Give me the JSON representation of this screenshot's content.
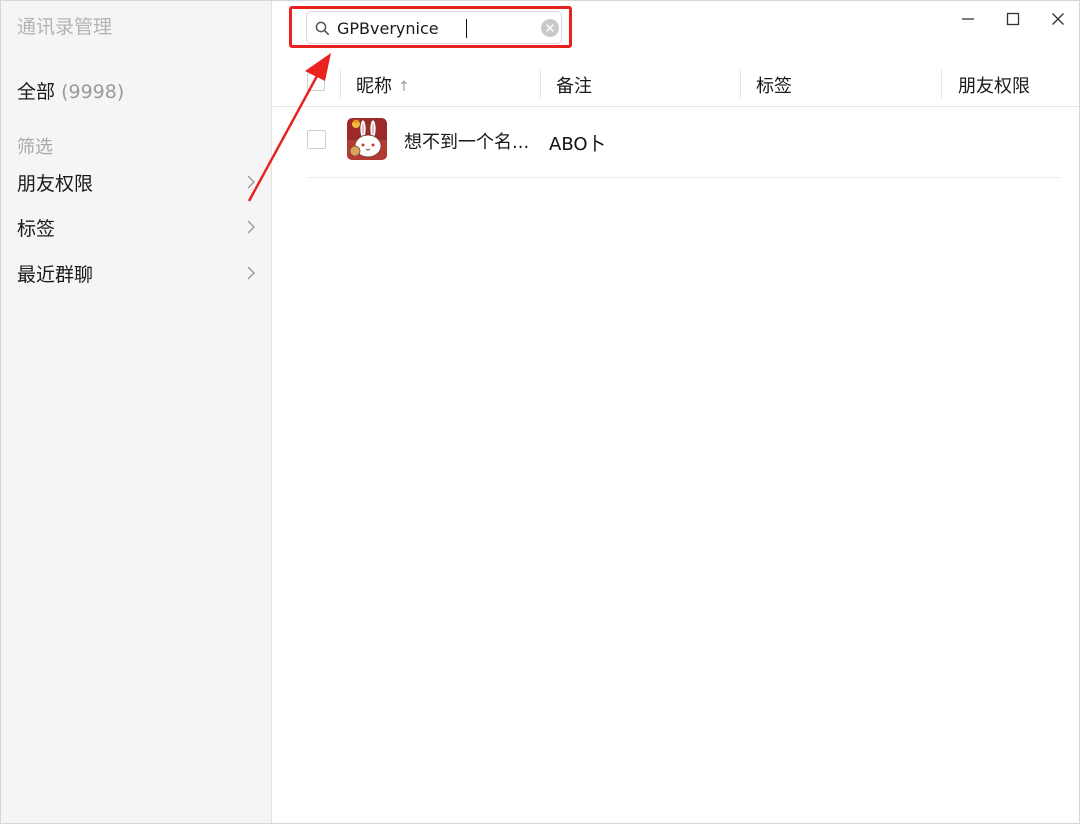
{
  "sidebar": {
    "title": "通讯录管理",
    "all_label": "全部",
    "all_count": "(9998)",
    "filter_label": "筛选",
    "items": [
      {
        "label": "朋友权限"
      },
      {
        "label": "标签"
      },
      {
        "label": "最近群聊"
      }
    ]
  },
  "search": {
    "value": "GPBverynice",
    "placeholder": "",
    "icon": "search-icon",
    "clear_icon": "clear-icon"
  },
  "window_controls": [
    "minimize-icon",
    "maximize-icon",
    "close-icon"
  ],
  "table": {
    "columns": {
      "nickname": "昵称",
      "sort_arrow": "↑",
      "remark": "备注",
      "tag": "标签",
      "permission": "朋友权限"
    },
    "rows": [
      {
        "nickname": "想不到一个名...",
        "remark": "ABO卜",
        "tag": "",
        "permission": ""
      }
    ]
  },
  "colors": {
    "highlight": "#e8231f",
    "sidebar_bg": "#f5f5f5"
  }
}
